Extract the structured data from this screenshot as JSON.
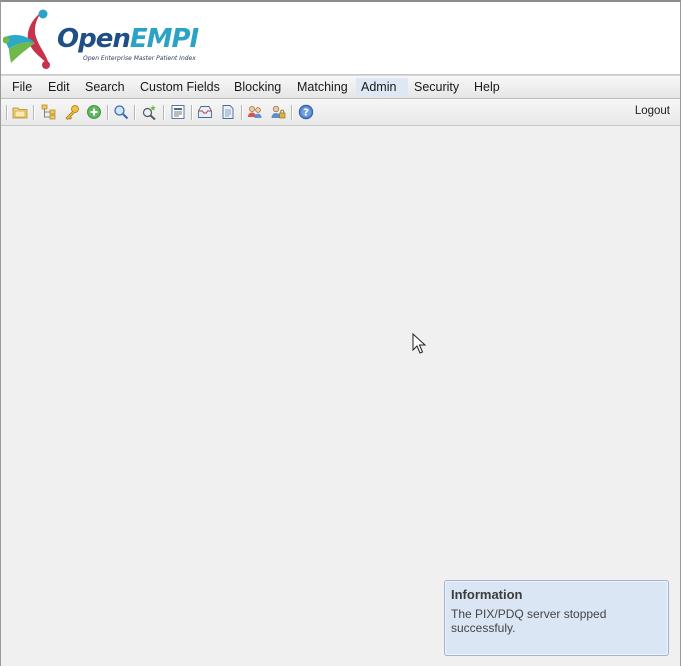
{
  "app": {
    "logo": {
      "word_open": "Open",
      "word_empi": "EMPI",
      "tagline": "Open Enterprise Master Patient Index"
    }
  },
  "menubar": {
    "items": [
      {
        "label": "File"
      },
      {
        "label": "Edit"
      },
      {
        "label": "Search"
      },
      {
        "label": "Custom Fields"
      },
      {
        "label": "Blocking"
      },
      {
        "label": "Matching"
      },
      {
        "label": "Admin"
      },
      {
        "label": "Security"
      },
      {
        "label": "Help"
      }
    ],
    "active": "Admin"
  },
  "toolbar": {
    "icons": [
      "open-folder-icon",
      "tree-icon",
      "key-icon",
      "add-icon",
      "search-icon",
      "advanced-search-icon",
      "report-icon",
      "inbox-icon",
      "document-icon",
      "users-icon",
      "user-lock-icon",
      "help-icon"
    ],
    "logout_label": "Logout"
  },
  "notification": {
    "title": "Information",
    "message": "The PIX/PDQ server stopped successfuly."
  },
  "colors": {
    "accent_active_menu": "#dde8f4",
    "info_background": "#dbe6f5",
    "logo_open": "#1f4f86",
    "logo_empi": "#2aa3c7"
  }
}
